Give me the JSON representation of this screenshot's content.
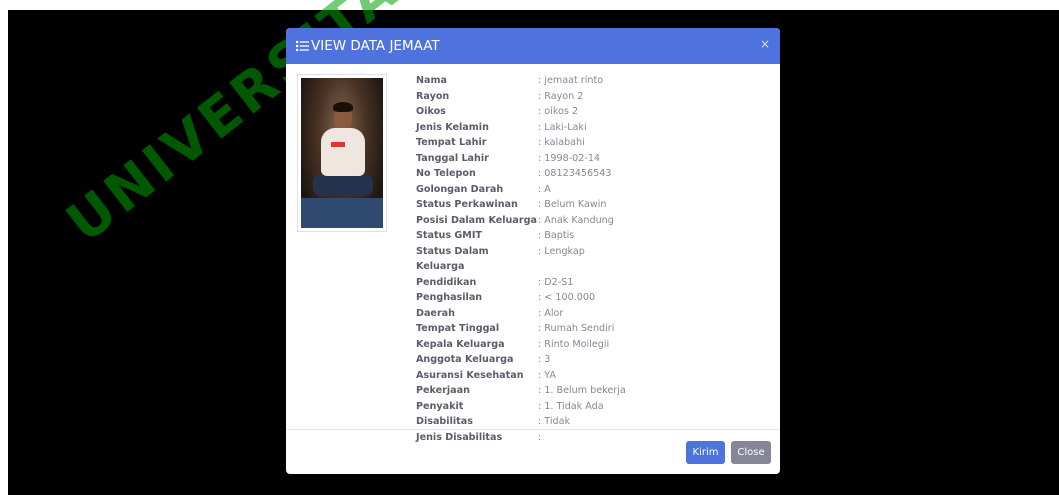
{
  "watermark": {
    "text": "UNIVERSITAS"
  },
  "modal": {
    "title": "VIEW DATA JEMAAT",
    "close_glyph": "×",
    "header_icon": "list-icon",
    "header_color": "#4e73df",
    "photo": {
      "icon": "person-photo"
    },
    "fields": [
      {
        "label": "Nama",
        "value": ": jemaat rinto"
      },
      {
        "label": "Rayon",
        "value": ": Rayon 2"
      },
      {
        "label": "Oikos",
        "value": ": oikos 2"
      },
      {
        "label": "Jenis Kelamin",
        "value": ": Laki-Laki"
      },
      {
        "label": "Tempat Lahir",
        "value": ": kalabahi"
      },
      {
        "label": "Tanggal Lahir",
        "value": ": 1998-02-14"
      },
      {
        "label": "No Telepon",
        "value": ": 08123456543"
      },
      {
        "label": "Golongan Darah",
        "value": ": A"
      },
      {
        "label": "Status Perkawinan",
        "value": ": Belum Kawin"
      },
      {
        "label": "Posisi Dalam Keluarga",
        "value": ": Anak Kandung"
      },
      {
        "label": "Status GMIT",
        "value": ": Baptis"
      },
      {
        "label": "Status Dalam Keluarga",
        "value": ": Lengkap"
      },
      {
        "label": "Pendidikan",
        "value": ": D2-S1"
      },
      {
        "label": "Penghasilan",
        "value": ": < 100.000"
      },
      {
        "label": "Daerah",
        "value": ": Alor"
      },
      {
        "label": "Tempat Tinggal",
        "value": ": Rumah Sendiri"
      },
      {
        "label": "Kepala Keluarga",
        "value": ": Rinto Moilegii"
      },
      {
        "label": "Anggota Keluarga",
        "value": ": 3"
      },
      {
        "label": "Asuransi Kesehatan",
        "value": ": YA"
      },
      {
        "label": "Pekerjaan",
        "value": ": 1. Belum bekerja"
      },
      {
        "label": "Penyakit",
        "value": ": 1. Tidak Ada"
      },
      {
        "label": "Disabilitas",
        "value": ": Tidak"
      },
      {
        "label": "Jenis Disabilitas",
        "value": ":"
      }
    ],
    "buttons": {
      "submit_label": "Kirim",
      "close_label": "Close",
      "submit_color": "#4e73df",
      "close_color": "#858796"
    }
  }
}
